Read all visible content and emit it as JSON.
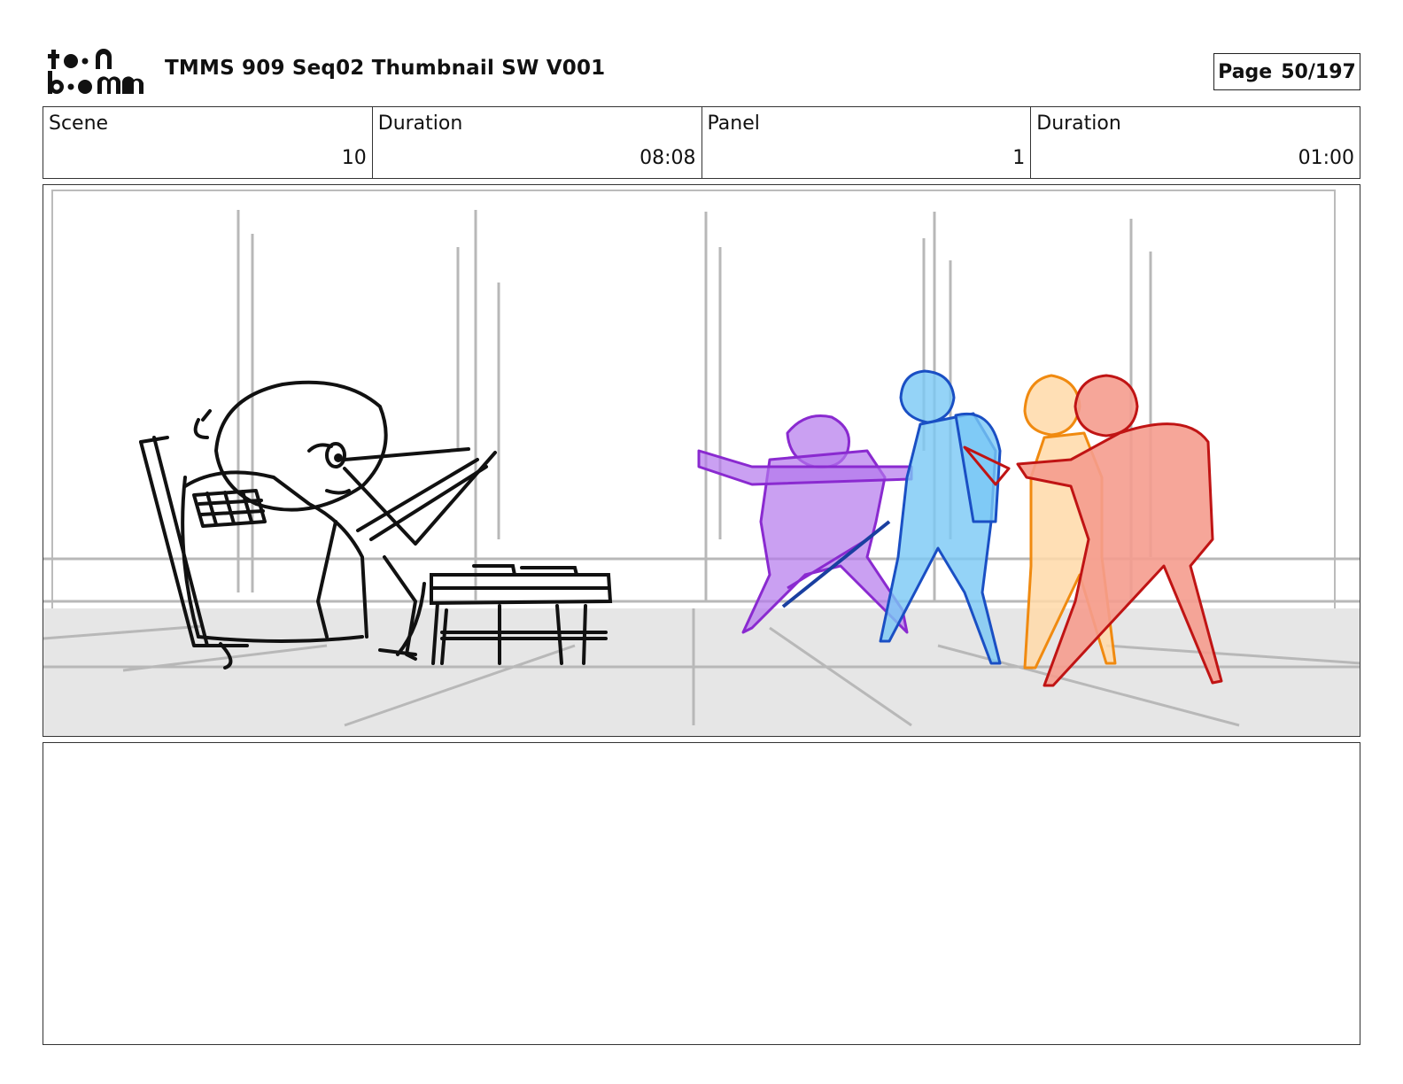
{
  "header": {
    "logo_text": "toonboom",
    "title": "TMMS 909 Seq02 Thumbnail SW V001",
    "page_label": "Page",
    "page_value": "50/197"
  },
  "info": {
    "scene_label": "Scene",
    "scene_value": "10",
    "scene_duration_label": "Duration",
    "scene_duration_value": "08:08",
    "panel_label": "Panel",
    "panel_value": "1",
    "panel_duration_label": "Duration",
    "panel_duration_value": "01:00"
  },
  "colors": {
    "character_purple": "#a347e6",
    "character_blue": "#6fc4f5",
    "character_orange": "#f7a233",
    "character_red": "#e84a3a"
  }
}
